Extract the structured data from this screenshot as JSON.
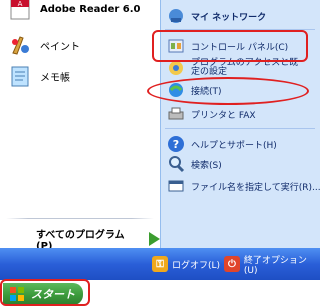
{
  "left_pane": {
    "pinned": [
      {
        "label": "Adobe Reader 6.0",
        "icon": "adobe-reader-icon"
      },
      {
        "label": "ペイント",
        "icon": "paint-icon"
      },
      {
        "label": "メモ帳",
        "icon": "notepad-icon"
      }
    ],
    "all_programs": "すべてのプログラム(P)"
  },
  "right_pane": {
    "items": [
      {
        "label": "マイ ネットワーク",
        "icon": "my-network-icon"
      },
      {
        "label": "コントロール パネル(C)",
        "icon": "control-panel-icon"
      },
      {
        "label": "プログラムのアクセスと既定の設定",
        "icon": "program-access-icon"
      },
      {
        "label": "接続(T)",
        "icon": "connect-icon"
      },
      {
        "label": "プリンタと FAX",
        "icon": "printer-icon"
      },
      {
        "label": "ヘルプとサポート(H)",
        "icon": "help-icon"
      },
      {
        "label": "検索(S)",
        "icon": "search-icon"
      },
      {
        "label": "ファイル名を指定して実行(R)...",
        "icon": "run-icon"
      }
    ]
  },
  "bottom_bar": {
    "logoff": "ログオフ(L)",
    "shutdown": "終了オプション(U)"
  },
  "taskbar": {
    "start": "スタート"
  },
  "colors": {
    "highlight": "#e02020",
    "start_green": "#3b9a3b",
    "bar_blue": "#2a5fd8",
    "right_pane_bg": "#d3e5fa"
  }
}
